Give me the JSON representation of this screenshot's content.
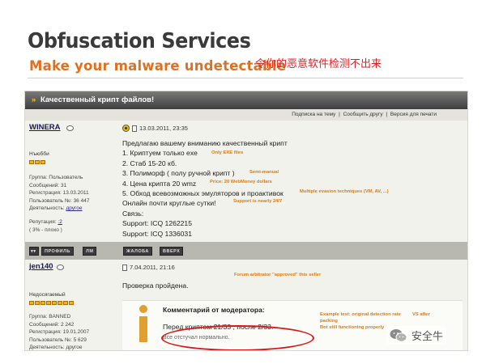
{
  "slide": {
    "title": "Obfuscation Services",
    "subtitle": "Make your malware undetectable",
    "chinese_caption": "令你的恶意软件检测不出来"
  },
  "thread": {
    "title": "Качественный крипт файлов!",
    "lead_glyph": "»",
    "action_links": [
      "Подписка на тему",
      "Сообщить другу",
      "Версия для печати"
    ]
  },
  "post1": {
    "username": "WINERA",
    "rank": "Нъюбби",
    "stars": 3,
    "meta": {
      "group": "Группа: Пользователь",
      "messages": "Сообщений: 31",
      "registered": "Регистрация: 13.03.2011",
      "user_no": "Пользователь №: 36 447",
      "activity_label": "Деятельность: ",
      "activity_value": "другое",
      "reputation_label": "Репутация: ",
      "reputation_value": ":2",
      "reputation_pct": "( 3% - плохо )"
    },
    "date": "13.03.2011, 23:35",
    "lines": [
      "Предлагаю вашему вниманию качественный крипт",
      "1. Криптуем только exe",
      "2. Стаб 15-20 кб.",
      "3. Полиморф ( полу ручной крипт )",
      "4. Цена крипта 20 wmz",
      "5. Обход всевозможных эмуляторов и проактивок",
      "Онлайн почти круглые сутки!",
      "Связь:",
      "Support: ICQ 1262215",
      "Support: ICQ 1336031"
    ],
    "notes": {
      "only_exe": "Only EXE files",
      "semi_manual": "Semi-manual",
      "price": "Price: 20 WebMoney dollars",
      "evasion": "Multiple evasion techniques (VM, AV, ...)",
      "support": "Support is nearly 24/7"
    },
    "buttons": {
      "profile": "ПРОФИЛЬ",
      "pm": "ЛМ",
      "complaint": "ЖАЛОБА",
      "up": "ВВЕРХ"
    }
  },
  "post2": {
    "username": "jen140",
    "rank": "Недосягаемый",
    "stars": 8,
    "meta": {
      "group": "Группа: BANNED",
      "messages": "Сообщений: 2 242",
      "registered": "Регистрация: 19.01.2007",
      "user_no": "Пользователь №: 5 629",
      "activity": "Деятельность: другое"
    },
    "date": "7.04.2011, 21:16",
    "text": "Проверка пройдена.",
    "note_arbitrator": "Forum arbitrator \"approved\" this seller",
    "moderator": {
      "title": "Комментарий от модератора:",
      "text": "Перед криптом 21/33 , после 2/33.",
      "text2": "Все отстучал нормально."
    },
    "notes": {
      "test_line1": "Example test: original detection rate",
      "test_line1b": "VS after",
      "test_line2": "packing",
      "test_line3": "Bot still functioning properly"
    }
  },
  "watermark": {
    "text": "安全牛"
  }
}
